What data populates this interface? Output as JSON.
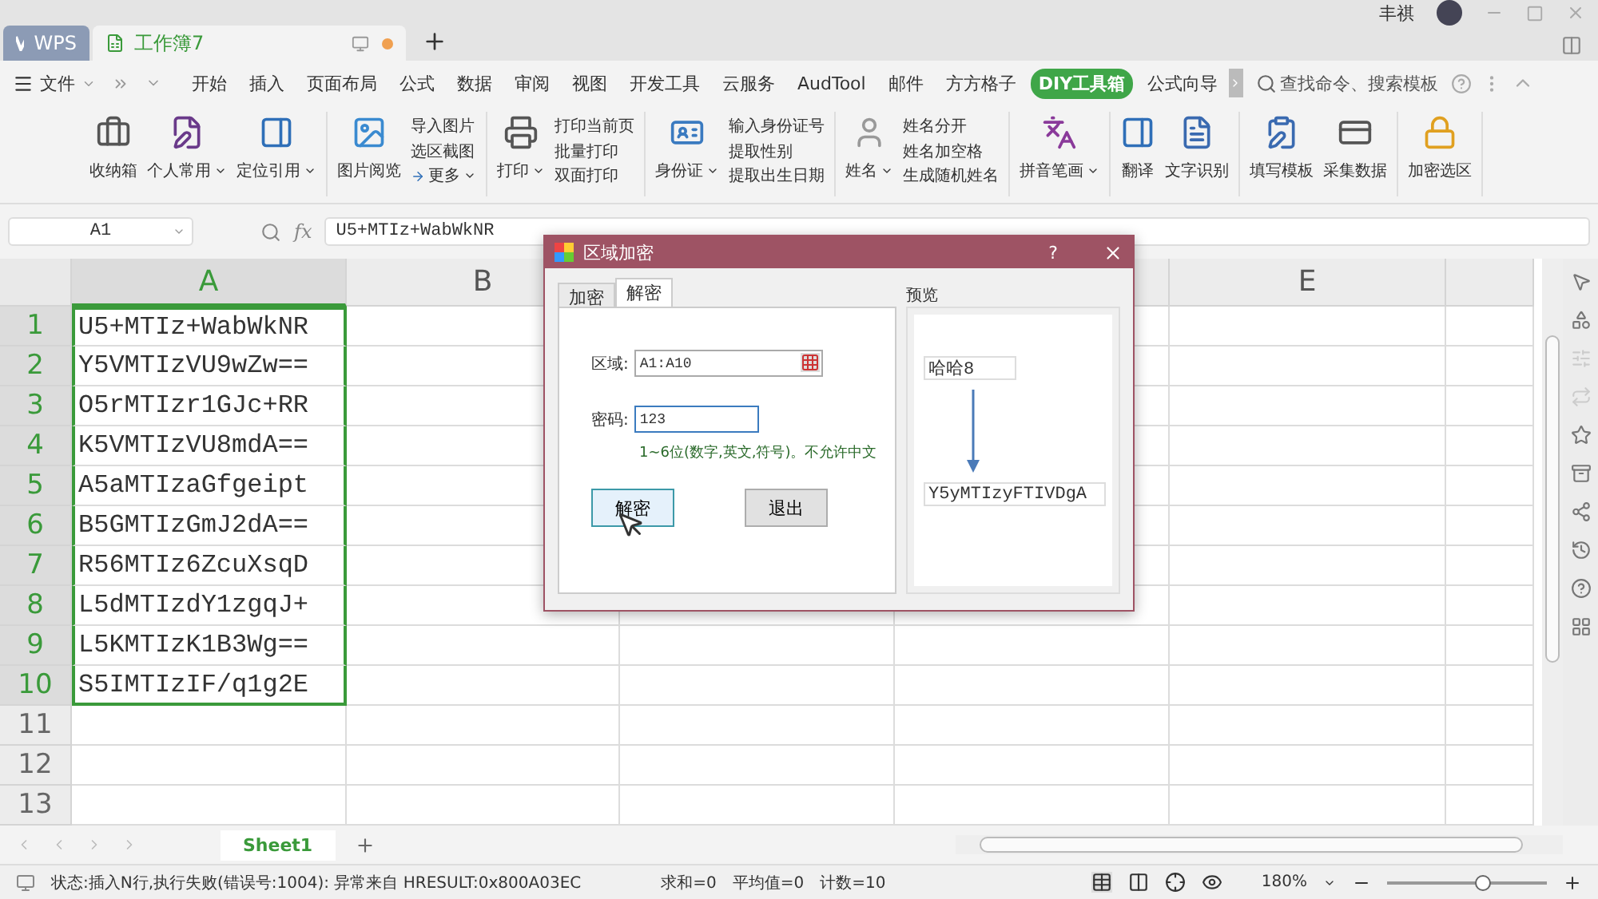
{
  "app_tabs": [
    {
      "label": "WPS",
      "selected": false
    },
    {
      "label": "工作簿7",
      "selected": true,
      "unsaved": true
    }
  ],
  "user": {
    "name": "丰祺"
  },
  "menu": {
    "file": "文件",
    "items": [
      {
        "label": "开始",
        "selected": false
      },
      {
        "label": "插入",
        "selected": false
      },
      {
        "label": "页面布局",
        "selected": false
      },
      {
        "label": "公式",
        "selected": false
      },
      {
        "label": "数据",
        "selected": false
      },
      {
        "label": "审阅",
        "selected": false
      },
      {
        "label": "视图",
        "selected": false
      },
      {
        "label": "开发工具",
        "selected": false
      },
      {
        "label": "云服务",
        "selected": false
      },
      {
        "label": "AudTool",
        "selected": false
      },
      {
        "label": "邮件",
        "selected": false
      },
      {
        "label": "方方格子",
        "selected": false
      },
      {
        "label": "DIY工具箱",
        "selected": true
      },
      {
        "label": "公式向导",
        "selected": false
      }
    ],
    "search_placeholder": "查找命令、搜索模板"
  },
  "ribbon": [
    {
      "items": [
        {
          "kind": "large",
          "label": "收纳箱",
          "dropdown": false
        },
        {
          "kind": "large",
          "label": "个人常用",
          "dropdown": true
        },
        {
          "kind": "large",
          "label": "定位引用",
          "dropdown": true
        }
      ]
    },
    {
      "items": [
        {
          "kind": "large",
          "label": "图片阅览",
          "dropdown": false
        },
        {
          "kind": "stack",
          "lines": [
            {
              "label": "导入图片",
              "dropdown": false
            },
            {
              "label": "选区截图",
              "dropdown": false
            },
            {
              "label": "更多",
              "dropdown": true,
              "arrow": true
            }
          ]
        }
      ]
    },
    {
      "items": [
        {
          "kind": "large",
          "label": "打印",
          "dropdown": true
        },
        {
          "kind": "stack",
          "lines": [
            {
              "label": "打印当前页",
              "dropdown": false
            },
            {
              "label": "批量打印",
              "dropdown": false
            },
            {
              "label": "双面打印",
              "dropdown": false
            }
          ]
        }
      ]
    },
    {
      "items": [
        {
          "kind": "large",
          "label": "身份证",
          "dropdown": true
        },
        {
          "kind": "stack",
          "lines": [
            {
              "label": "输入身份证号",
              "dropdown": false
            },
            {
              "label": "提取性别",
              "dropdown": false
            },
            {
              "label": "提取出生日期",
              "dropdown": false
            }
          ]
        }
      ]
    },
    {
      "items": [
        {
          "kind": "large",
          "label": "姓名",
          "dropdown": true
        },
        {
          "kind": "stack",
          "lines": [
            {
              "label": "姓名分开",
              "dropdown": false
            },
            {
              "label": "姓名加空格",
              "dropdown": false
            },
            {
              "label": "生成随机姓名",
              "dropdown": false
            }
          ]
        }
      ]
    },
    {
      "items": [
        {
          "kind": "large",
          "label": "拼音笔画",
          "dropdown": true
        }
      ]
    },
    {
      "items": [
        {
          "kind": "large",
          "label": "翻译",
          "dropdown": false
        },
        {
          "kind": "large",
          "label": "文字识别",
          "dropdown": false
        }
      ]
    },
    {
      "items": [
        {
          "kind": "large",
          "label": "填写模板",
          "dropdown": false
        },
        {
          "kind": "large",
          "label": "采集数据",
          "dropdown": false
        }
      ]
    },
    {
      "items": [
        {
          "kind": "large",
          "label": "加密选区",
          "dropdown": false
        }
      ]
    }
  ],
  "formula_bar": {
    "name_box": "A1",
    "fx": "fx",
    "formula": "U5+MTIz+WabWkNR"
  },
  "sheet": {
    "columns": [
      {
        "label": "A",
        "selected": true
      },
      {
        "label": "B",
        "selected": false
      },
      {
        "label": "E",
        "selected": false
      }
    ],
    "rows": [
      {
        "number": "1",
        "selected": true,
        "a": "U5+MTIz+WabWkNR"
      },
      {
        "number": "2",
        "selected": true,
        "a": "Y5VMTIzVU9wZw=="
      },
      {
        "number": "3",
        "selected": true,
        "a": "O5rMTIzr1GJc+RR"
      },
      {
        "number": "4",
        "selected": true,
        "a": "K5VMTIzVU8mdA=="
      },
      {
        "number": "5",
        "selected": true,
        "a": "A5aMTIzaGfgeipt"
      },
      {
        "number": "6",
        "selected": true,
        "a": "B5GMTIzGmJ2dA=="
      },
      {
        "number": "7",
        "selected": true,
        "a": "R56MTIz6ZcuXsqD"
      },
      {
        "number": "8",
        "selected": true,
        "a": "L5dMTIzdY1zgqJ+"
      },
      {
        "number": "9",
        "selected": true,
        "a": "L5KMTIzK1B3Wg=="
      },
      {
        "number": "10",
        "selected": true,
        "a": "S5IMTIzIF/q1g2E"
      },
      {
        "number": "11",
        "selected": false
      },
      {
        "number": "12",
        "selected": false
      },
      {
        "number": "13",
        "selected": false
      }
    ]
  },
  "dialog": {
    "title": "区域加密",
    "help": "?",
    "tabs": [
      {
        "label": "加密",
        "selected": false
      },
      {
        "label": "解密",
        "selected": true
      }
    ],
    "range_label": "区域:",
    "range_value": "A1:A10",
    "password_label": "密码:",
    "password_value": "123",
    "hint": "1~6位(数字,英文,符号)。不允许中文",
    "buttons": [
      {
        "label": "解密",
        "hovered": true
      },
      {
        "label": "退出",
        "hovered": false
      }
    ],
    "preview": {
      "title": "预览",
      "input": "哈哈8",
      "output": "Y5yMTIzyFTIVDgA"
    }
  },
  "sheet_tabs": [
    {
      "label": "Sheet1",
      "selected": true
    }
  ],
  "status_bar": {
    "message": "状态:插入N行,执行失败(错误号:1004): 异常来自 HRESULT:0x800A03EC",
    "sum": "求和=0",
    "average": "平均值=0",
    "count": "计数=10",
    "zoom": "180%",
    "zoom_slider": {
      "level": 0.6
    }
  }
}
